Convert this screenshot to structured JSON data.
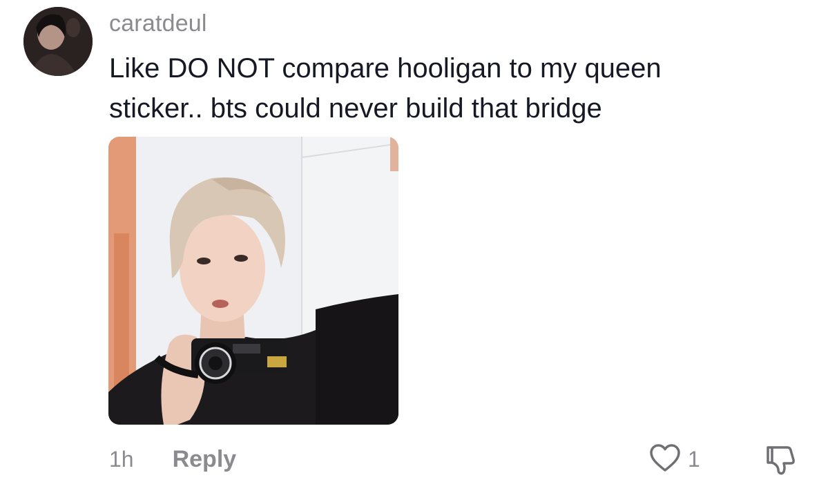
{
  "comment": {
    "username": "caratdeul",
    "text_line1": "Like DO NOT compare hooligan to my queen",
    "text_line2": "sticker.. bts could never build that bridge",
    "timestamp": "1h",
    "reply_label": "Reply",
    "like_count": "1",
    "avatar_icon": "user-avatar-photo",
    "sticker_image": "person-holding-camcorder-photo",
    "like_icon": "heart-outline-icon",
    "dislike_icon": "thumbs-down-icon"
  },
  "colors": {
    "muted_text": "#8a8a8f",
    "body_text": "#161823",
    "background": "#ffffff"
  }
}
